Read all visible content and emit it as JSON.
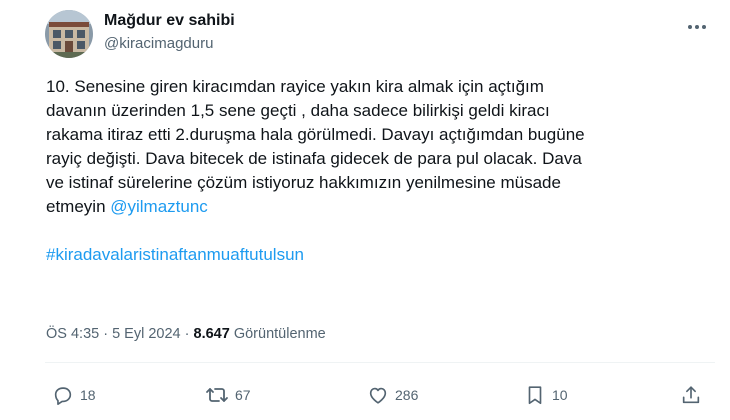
{
  "author": {
    "name": "Mağdur ev sahibi",
    "handle": "@kiracimagduru"
  },
  "tweet": {
    "lines": [
      "10. Senesine giren kiracımdan rayice yakın kira almak için açtığım",
      "davanın üzerinden 1,5 sene geçti , daha sadece bilirkişi geldi kiracı",
      "rakama  itiraz etti 2.duruşma hala görülmedi. Davayı açtığımdan bugüne",
      "rayiç değişti. Dava bitecek de istinafa gidecek de para pul olacak. Dava",
      "ve istinaf sürelerine çözüm istiyoruz hakkımızın yenilmesine müsade"
    ],
    "last_line_prefix": "etmeyin ",
    "mention": "@yilmaztunc",
    "hashtag": "#kiradavalaristinaftanmuaftutulsun"
  },
  "meta": {
    "time": "ÖS 4:35",
    "separator": " · ",
    "date": "5 Eyl 2024",
    "views_count": "8.647",
    "views_label": " Görüntülenme"
  },
  "actions": {
    "replies": "18",
    "retweets": "67",
    "likes": "286",
    "bookmarks": "10"
  },
  "colors": {
    "accent": "#1d9bf0",
    "secondary_text": "#536471",
    "primary_text": "#0f1419",
    "divider": "#eff3f4"
  },
  "icons": [
    "more-horizontal-icon",
    "reply-icon",
    "retweet-icon",
    "like-icon",
    "bookmark-icon",
    "share-icon"
  ]
}
